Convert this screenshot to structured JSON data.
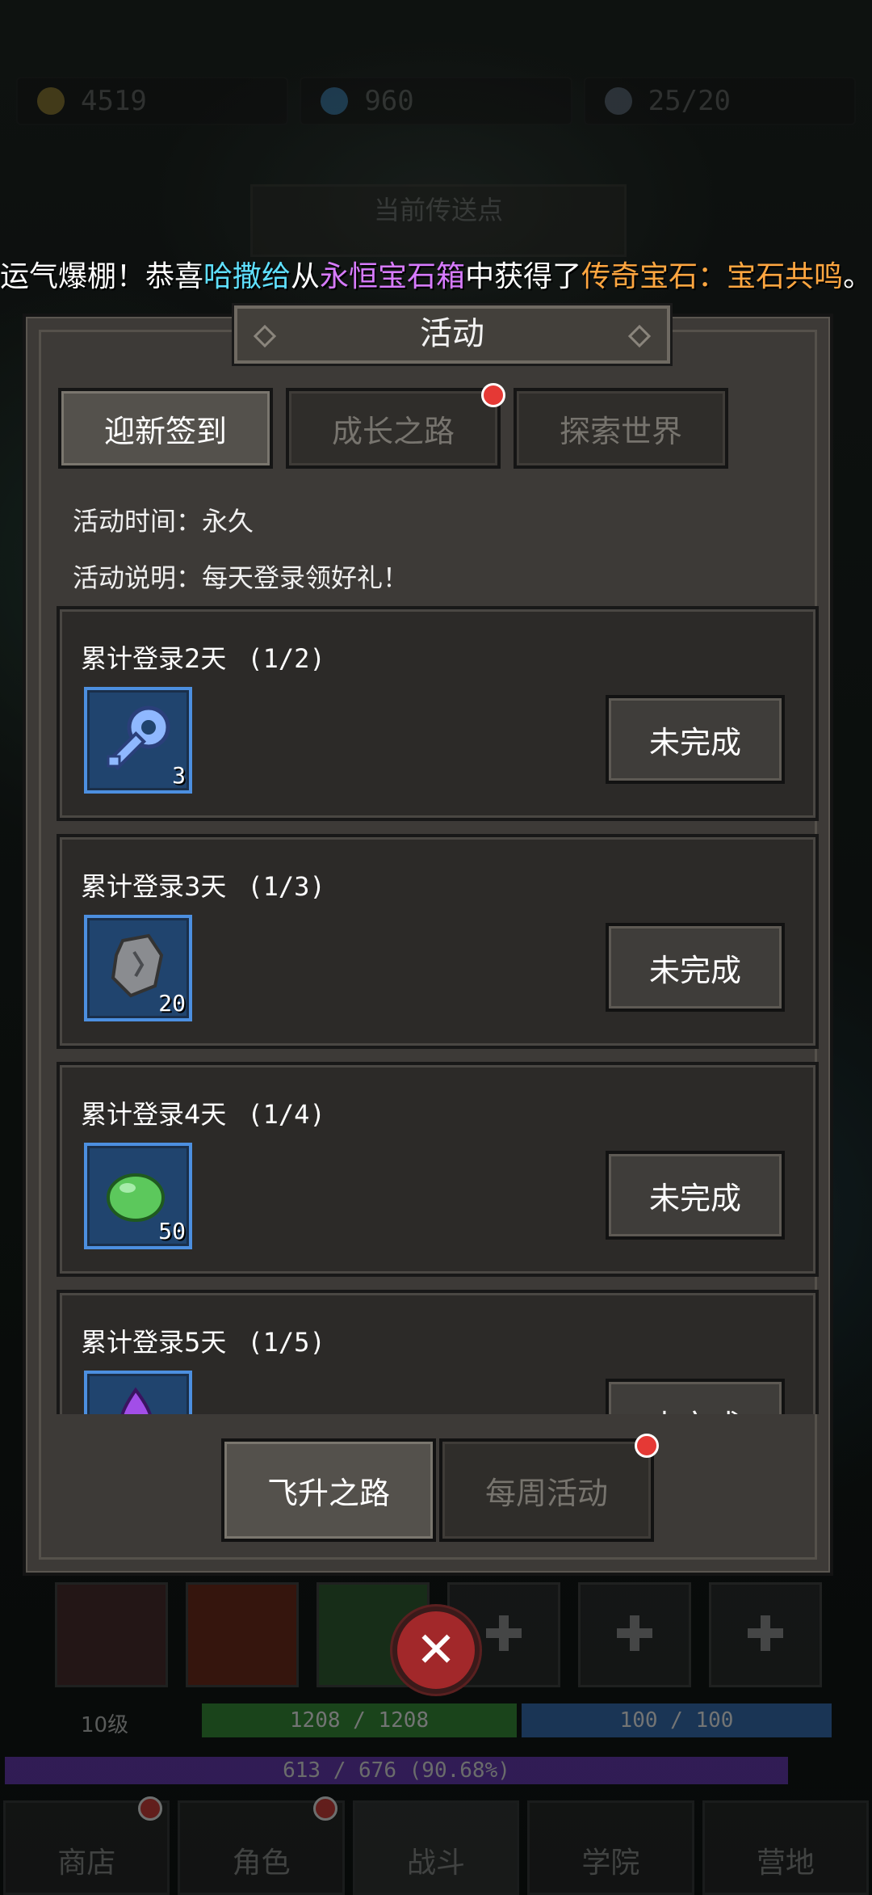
{
  "currencies": [
    {
      "icon": "gold-coin-icon",
      "value": "4519"
    },
    {
      "icon": "blue-gem-icon",
      "value": "960"
    },
    {
      "icon": "feather-icon",
      "value": "25/20"
    }
  ],
  "portal_label": "当前传送点",
  "marquee": {
    "prefix": "运气爆棚！恭喜",
    "player": "哈撒给",
    "from": "从",
    "source": "永恒宝石箱",
    "got": "中获得了",
    "item": "传奇宝石：宝石共鸣",
    "end": "。"
  },
  "panel": {
    "title": "活动",
    "tabs": [
      {
        "label": "迎新签到",
        "active": true,
        "badge": false
      },
      {
        "label": "成长之路",
        "active": false,
        "badge": true
      },
      {
        "label": "探索世界",
        "active": false,
        "badge": false
      }
    ],
    "time_label": "活动时间：永久",
    "desc_label": "活动说明：每天登录领好礼！",
    "tasks": [
      {
        "title": "累计登录2天",
        "progress": "(1/2)",
        "reward_icon": "blue-key-icon",
        "qty": "3",
        "status": "未完成"
      },
      {
        "title": "累计登录3天",
        "progress": "(1/3)",
        "reward_icon": "stone-ore-icon",
        "qty": "20",
        "status": "未完成"
      },
      {
        "title": "累计登录4天",
        "progress": "(1/4)",
        "reward_icon": "green-slime-icon",
        "qty": "50",
        "status": "未完成"
      },
      {
        "title": "累计登录5天",
        "progress": "(1/5)",
        "reward_icon": "purple-crystal-icon",
        "qty": "",
        "status": "未完成"
      }
    ],
    "bottom_tabs": [
      {
        "label": "飞升之路",
        "active": true,
        "badge": false
      },
      {
        "label": "每周活动",
        "active": false,
        "badge": true
      }
    ]
  },
  "close_label": "✕",
  "hud": {
    "level": "10级",
    "hp": "1208 / 1208",
    "mp": "100 / 100",
    "xp": "613 / 676 (90.68%)"
  },
  "nav": [
    {
      "label": "商店",
      "badge": true
    },
    {
      "label": "角色",
      "badge": true
    },
    {
      "label": "战斗",
      "badge": false
    },
    {
      "label": "学院",
      "badge": false
    },
    {
      "label": "营地",
      "badge": false
    }
  ],
  "colors": {
    "accent_red": "#e53935",
    "reward_frame": "#4c8fe0",
    "marquee_player": "#5fe0ff",
    "marquee_source": "#d77bff",
    "marquee_item": "#ffa640"
  }
}
